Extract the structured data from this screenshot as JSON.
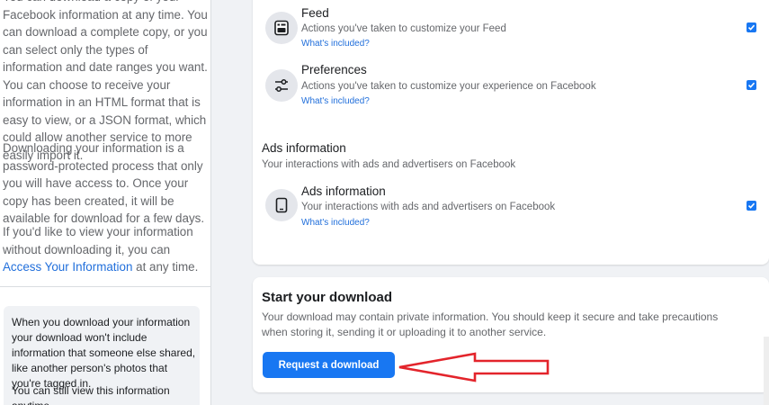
{
  "left_panel": {
    "paragraph1": {
      "text": "You can download a copy of your Facebook information at any time. You can download a complete copy, or you can select only the types of information and date ranges you want. You can choose to receive your information in an HTML format that is easy to view, or a JSON format, which could allow another service to more easily import it."
    },
    "paragraph2": {
      "text": "Downloading your information is a password-protected process that only you will have access to. Once your copy has been created, it will be available for download for a few days."
    },
    "paragraph3": {
      "prefix": "If you'd like to view your information without downloading it, you can ",
      "link": "Access Your Information",
      "suffix": " at any time."
    },
    "notice": {
      "text1": "When you download your information your download won't include information that someone else shared, like another person's photos that you're tagged in.",
      "text2": "You can still view this information anytime."
    }
  },
  "categories": {
    "items": [
      {
        "title": "Feed",
        "description": "Actions you've taken to customize your Feed",
        "link": "What's included?",
        "icon": "feed-icon",
        "checked": true
      },
      {
        "title": "Preferences",
        "description": "Actions you've taken to customize your experience on Facebook",
        "link": "What's included?",
        "icon": "sliders-icon",
        "checked": true
      }
    ],
    "ads_section": {
      "heading": "Ads information",
      "subheading": "Your interactions with ads and advertisers on Facebook",
      "item": {
        "title": "Ads information",
        "description": "Your interactions with ads and advertisers on Facebook",
        "link": "What's included?",
        "icon": "tablet-icon",
        "checked": true
      }
    }
  },
  "download": {
    "title": "Start your download",
    "description": "Your download may contain private information. You should keep it secure and take precautions when storing it, sending it or uploading it to another service.",
    "button_label": "Request a download"
  },
  "colors": {
    "accent": "#1877f2",
    "link": "#216fdb",
    "annotation_arrow": "#e3242b",
    "page_background": "#f0f2f5"
  }
}
